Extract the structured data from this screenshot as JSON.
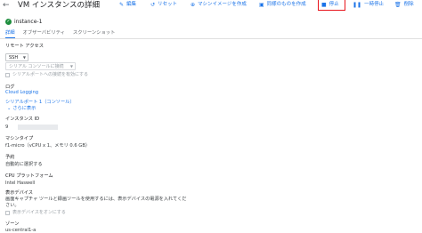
{
  "header": {
    "back_icon": "arrow-left-icon",
    "title": "VM インスタンスの詳細",
    "actions": [
      {
        "icon": "pencil-icon",
        "glyph": "✎",
        "label": "編集"
      },
      {
        "icon": "reset-icon",
        "glyph": "↺",
        "label": "リセット"
      },
      {
        "icon": "add-image-icon",
        "glyph": "⊕",
        "label": "マシンイメージを作成"
      },
      {
        "icon": "copy-icon",
        "glyph": "▣",
        "label": "同様のものを作成"
      },
      {
        "icon": "stop-icon",
        "glyph": "■",
        "label": "停止"
      },
      {
        "icon": "pause-icon",
        "glyph": "❚❚",
        "label": "一時停止"
      },
      {
        "icon": "trash-icon",
        "glyph": "🗑",
        "label": "削除"
      }
    ],
    "highlight_color": "#e8141b"
  },
  "instance": {
    "status_icon": "check-circle-icon",
    "name": "instance-1"
  },
  "tabs": [
    {
      "label": "詳細",
      "active": true
    },
    {
      "label": "オブザーバビリティ",
      "active": false
    },
    {
      "label": "スクリーンショット",
      "active": false
    }
  ],
  "remote_access": {
    "heading": "リモート アクセス",
    "ssh_label": "SSH",
    "serial_select": "シリアル コンソールに接続",
    "serial_checkbox": "シリアルポートへの接続を有効にする"
  },
  "logs": {
    "heading": "ログ",
    "cloud_logging": "Cloud Logging",
    "serial_port": "シリアルポート 1（コンソール）",
    "more": "さらに表示"
  },
  "instance_id": {
    "heading": "インスタンス ID",
    "value": "9"
  },
  "machine_type": {
    "heading": "マシンタイプ",
    "value": "f1-micro（vCPU x 1、メモリ 0.6 GB）"
  },
  "reservation": {
    "heading": "予約",
    "value": "自動的に選択する"
  },
  "cpu_platform": {
    "heading": "CPU プラットフォーム",
    "value": "Intel Haswell"
  },
  "display_device": {
    "heading": "表示デバイス",
    "description_line1": "画面キャプチャ ツールと録画ツールを使用するには、表示デバイスの電源を入れてくだ",
    "description_line2": "さい。",
    "checkbox": "表示デバイスをオンにする"
  },
  "zone": {
    "heading": "ゾーン",
    "value": "us-central1-a"
  }
}
